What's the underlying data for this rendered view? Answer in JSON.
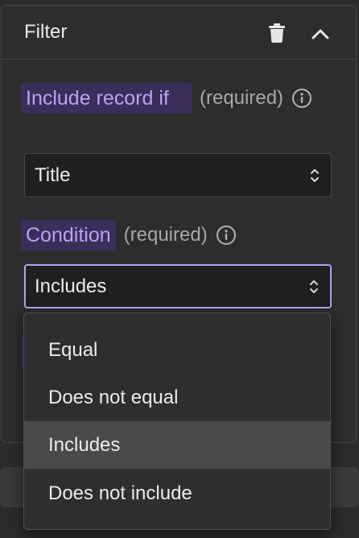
{
  "panel": {
    "title": "Filter",
    "icons": {
      "trash": "trash-icon",
      "collapse": "chevron-up-icon"
    }
  },
  "fields": [
    {
      "label": "Include record if",
      "required_text": "(required)",
      "value": "Title"
    },
    {
      "label": "Condition",
      "required_text": "(required)",
      "value": "Includes"
    }
  ],
  "dropdown": {
    "options": [
      {
        "label": "Equal",
        "selected": false
      },
      {
        "label": "Does not equal",
        "selected": false
      },
      {
        "label": "Includes",
        "selected": true
      },
      {
        "label": "Does not include",
        "selected": false
      }
    ]
  },
  "colors": {
    "background": "#2b2b2b",
    "label_highlight_bg": "#3a2e5a",
    "label_highlight_text": "#b8a4f4",
    "focus_border": "#b0a2f0",
    "selected_option_bg": "#4a4a4a"
  }
}
